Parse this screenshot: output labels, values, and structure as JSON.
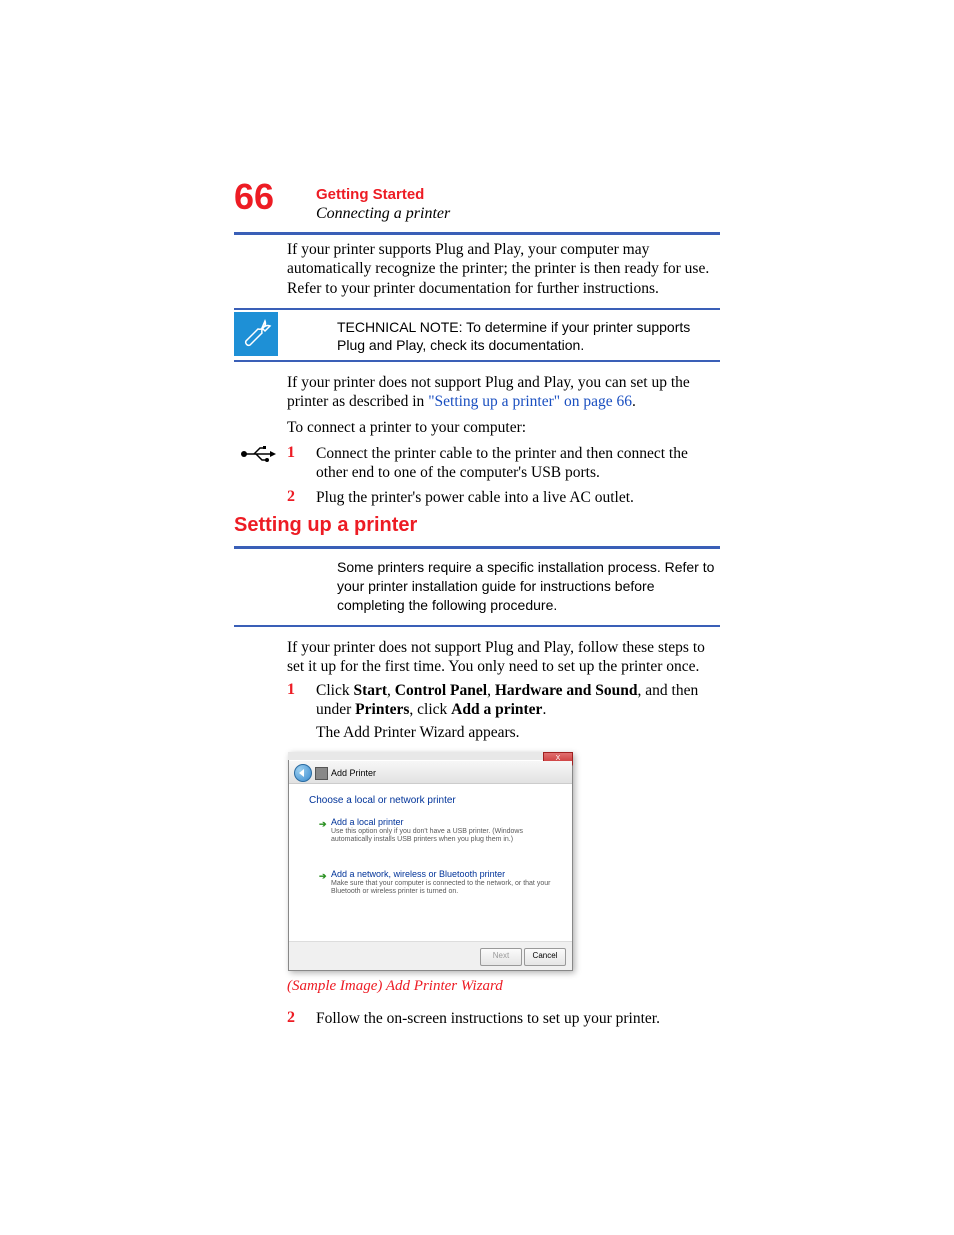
{
  "pageNumber": "66",
  "chapterTitle": "Getting Started",
  "sectionSubtitle": "Connecting a printer",
  "para1": "If your printer supports Plug and Play, your computer may automatically recognize the printer; the printer is then ready for use. Refer to your printer documentation for further instructions.",
  "techNoteLabel": "TECHNICAL NOTE:",
  "techNoteText": " To determine if your printer supports Plug and Play, check its documentation.",
  "para2a": "If your printer does not support Plug and Play, you can set up the printer as described in ",
  "para2link": "\"Setting up a printer\" on page 66",
  "para2b": ".",
  "para3": "To connect a printer to your computer:",
  "stepsA": {
    "n1": "1",
    "t1": "Connect the printer cable to the printer and then connect the other end to one of the computer's USB ports.",
    "n2": "2",
    "t2": "Plug the printer's power cable into a live AC outlet."
  },
  "h2": "Setting up a printer",
  "note2": "Some printers require a specific installation process. Refer to your printer installation guide for instructions before completing the following procedure.",
  "para4": "If your printer does not support Plug and Play, follow these steps to set it up for the first time. You only need to set up the printer once.",
  "stepsB": {
    "n1": "1",
    "t1a": "Click ",
    "t1b": "Start",
    "t1c": ", ",
    "t1d": "Control Panel",
    "t1e": ", ",
    "t1f": "Hardware and Sound",
    "t1g": ", and then under ",
    "t1h": "Printers",
    "t1i": ", click ",
    "t1j": "Add a printer",
    "t1k": ".",
    "para5": "The Add Printer Wizard appears.",
    "n2": "2",
    "t2": "Follow the on-screen instructions to set up your printer."
  },
  "dialog": {
    "closeX": "X",
    "title": "Add Printer",
    "heading": "Choose a local or network printer",
    "opt1Title": "Add a local printer",
    "opt1Desc": "Use this option only if you don't have a USB printer. (Windows automatically installs USB printers when you plug them in.)",
    "opt2Title": "Add a network, wireless or Bluetooth printer",
    "opt2Desc": "Make sure that your computer is connected to the network, or that your Bluetooth or wireless printer is turned on.",
    "next": "Next",
    "cancel": "Cancel"
  },
  "caption": "(Sample Image) Add Printer Wizard"
}
